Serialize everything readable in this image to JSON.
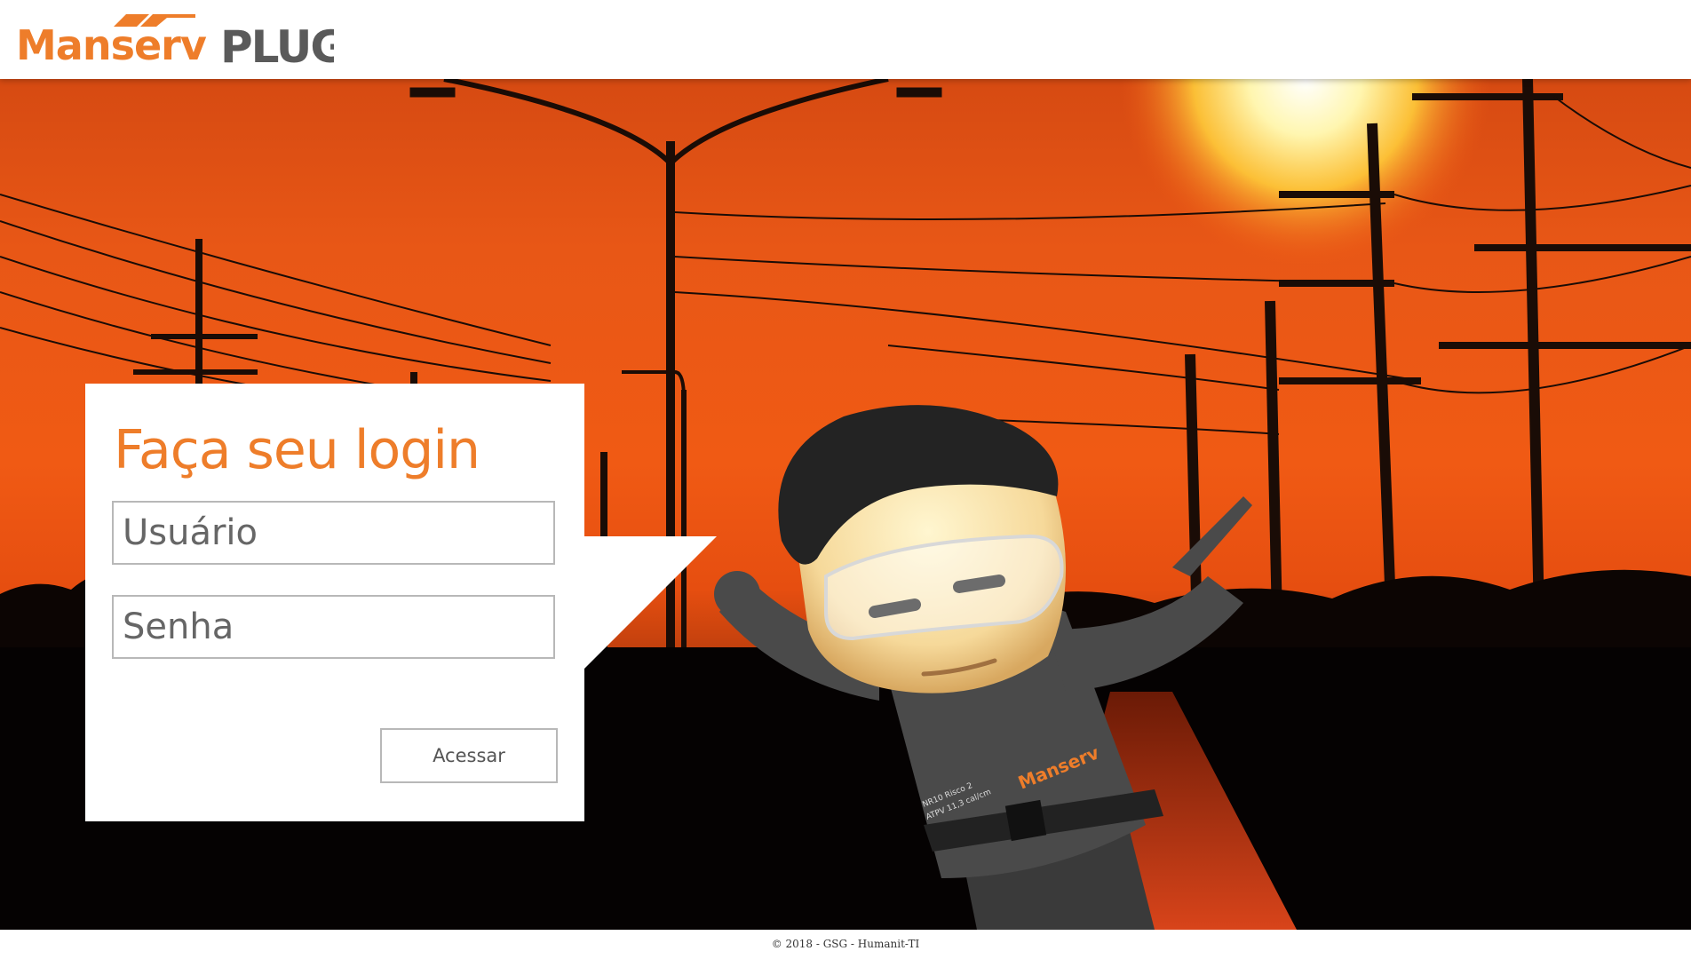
{
  "header": {
    "brand_name": "Manserv",
    "product_name": "PLUG"
  },
  "login": {
    "title": "Faça seu login",
    "username_placeholder": "Usuário",
    "password_placeholder": "Senha",
    "submit_label": "Acessar"
  },
  "mascot": {
    "shirt_brand": "Manserv",
    "badge_line1": "NR10 Risco 2",
    "badge_line2": "ATPV 11,3 cal/cm"
  },
  "footer": {
    "copyright": "© 2018 - GSG - Humanit-TI"
  },
  "colors": {
    "brand_orange": "#ee7d2a",
    "logo_gray": "#5a5a5a",
    "sky_orange": "#f05a14"
  }
}
